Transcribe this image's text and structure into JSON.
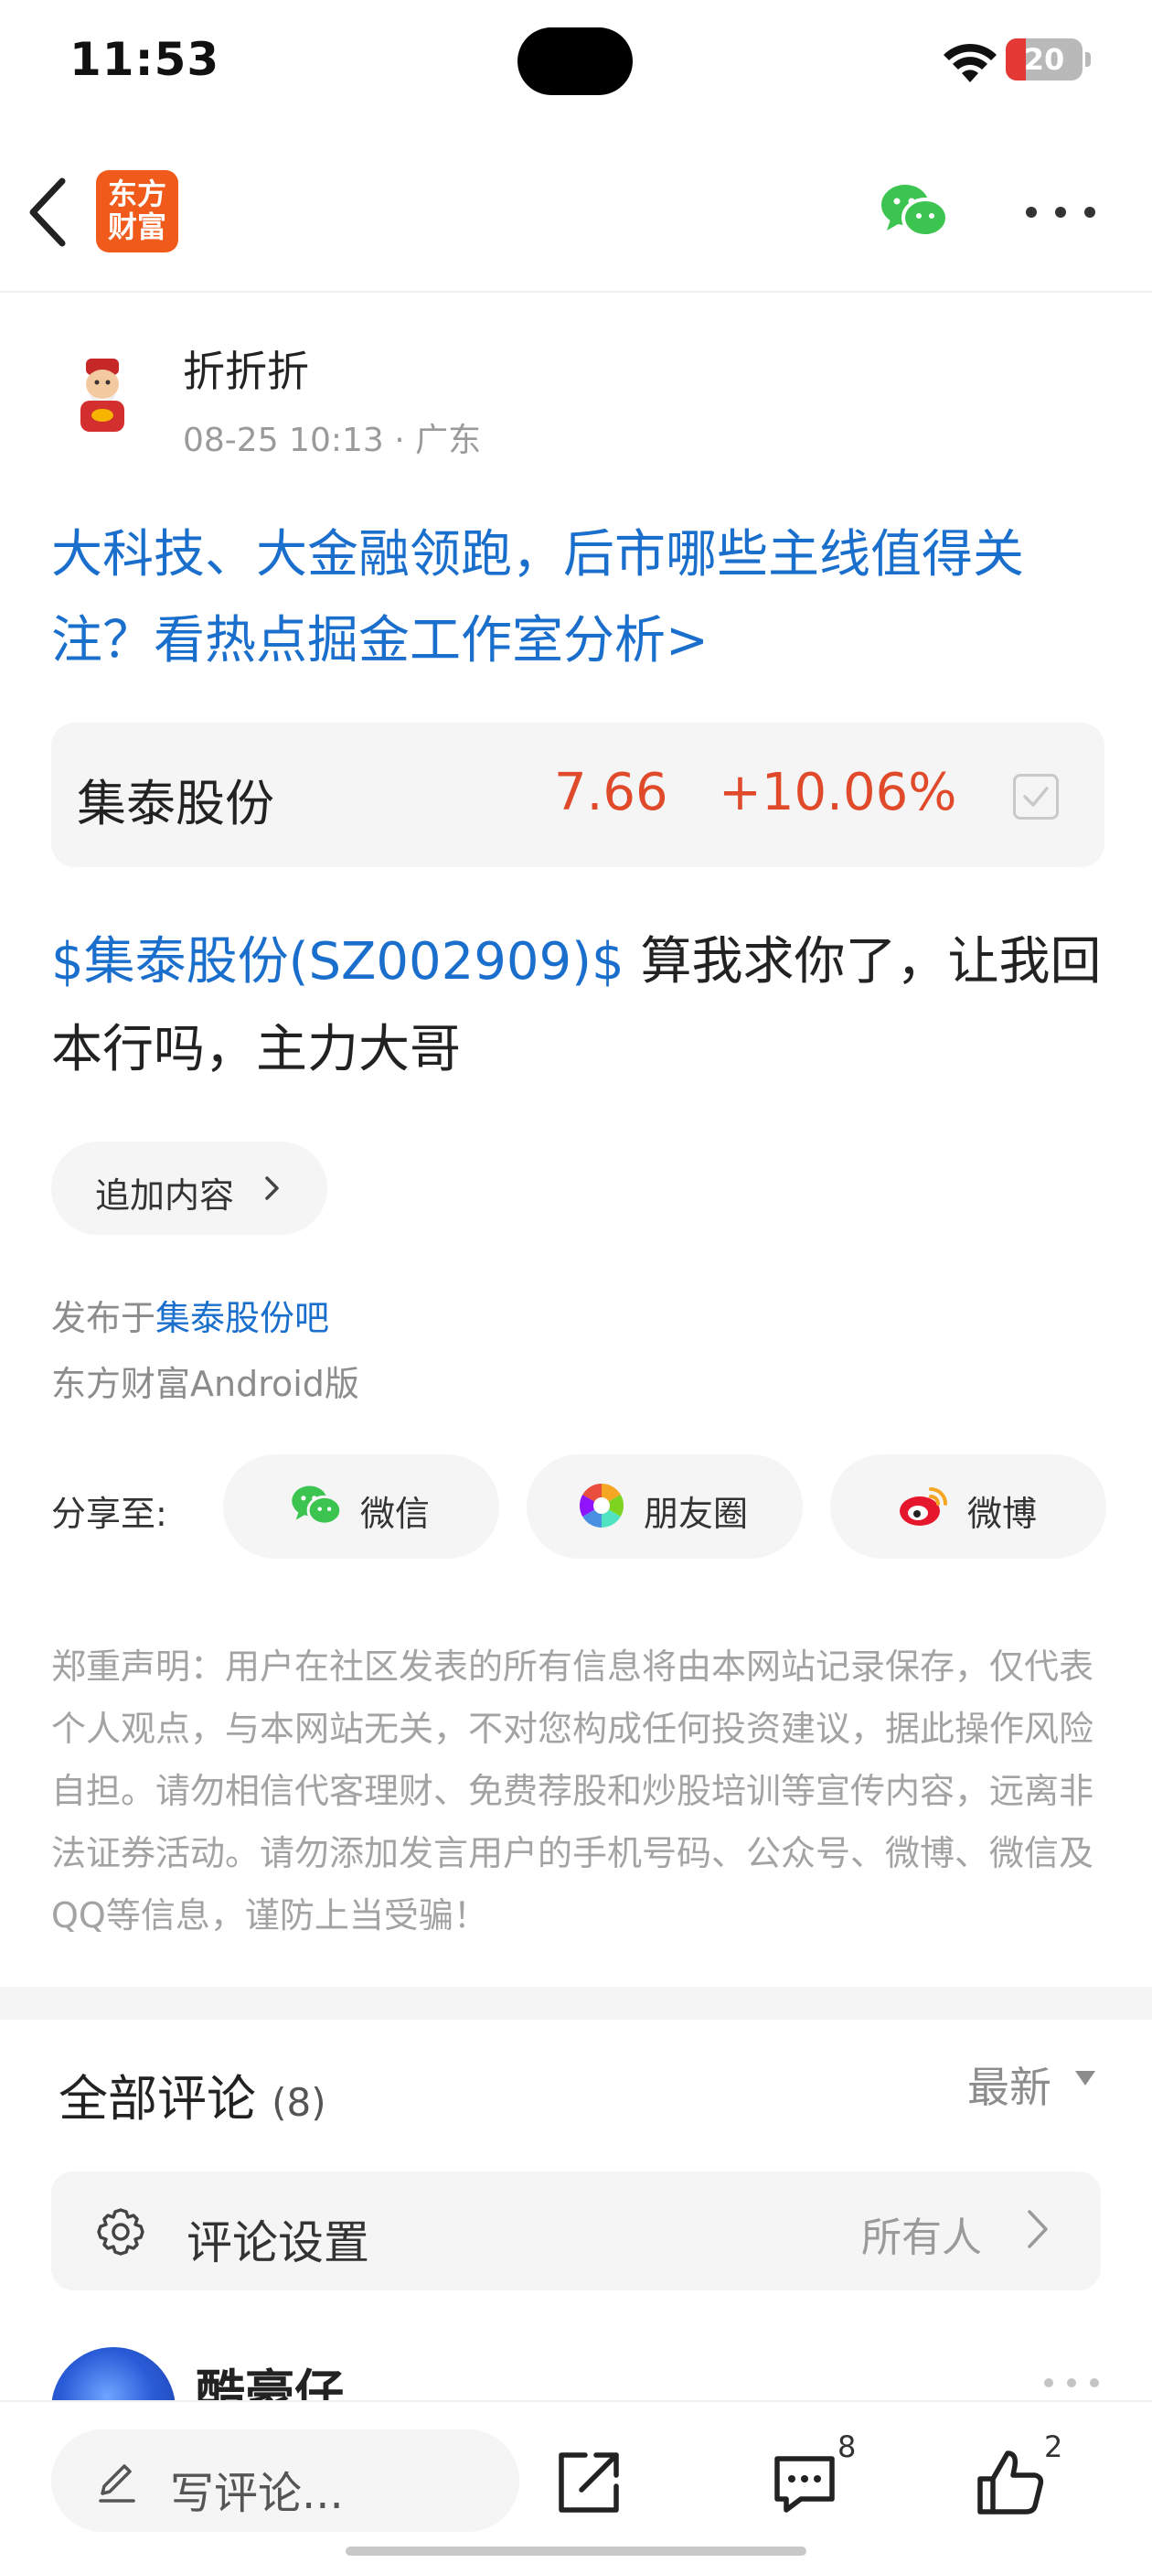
{
  "status_bar": {
    "time": "11:53",
    "battery": "20"
  },
  "nav": {
    "logo_line1": "东方",
    "logo_line2": "财富",
    "back_icon": "chevron-left-icon",
    "share_icon": "wechat-icon",
    "more_icon": "more-horizontal-icon"
  },
  "post": {
    "author": "折折折",
    "meta": "08-25 10:13 · 广东",
    "promo": "大科技、大金融领跑，后市哪些主线值得关注？看热点掘金工作室分析>",
    "stock": {
      "name": "集泰股份",
      "price": "7.66",
      "change": "+10.06%"
    },
    "tag": "$集泰股份(SZ002909)$",
    "text": " 算我求你了，让我回本行吗，主力大哥",
    "append_label": "追加内容",
    "published_prefix": "发布于",
    "forum": "集泰股份吧",
    "client": "东方财富Android版"
  },
  "share": {
    "label": "分享至:",
    "wechat": "微信",
    "moments": "朋友圈",
    "weibo": "微博"
  },
  "disclaimer": "郑重声明：用户在社区发表的所有信息将由本网站记录保存，仅代表个人观点，与本网站无关，不对您构成任何投资建议，据此操作风险自担。请勿相信代客理财、免费荐股和炒股培训等宣传内容，远离非法证券活动。请勿添加发言用户的手机号码、公众号、微博、微信及QQ等信息，谨防上当受骗！",
  "comments": {
    "title": "全部评论",
    "count": "(8)",
    "sort": "最新",
    "settings_label": "评论设置",
    "settings_value": "所有人",
    "first_commenter": "酷豪仔"
  },
  "bottom_bar": {
    "placeholder": "写评论...",
    "comment_count": "8",
    "like_count": "2"
  },
  "colors": {
    "link_blue": "#1a6fcd",
    "rise_red": "#e04a2a",
    "logo_orange": "#f05a1a"
  }
}
